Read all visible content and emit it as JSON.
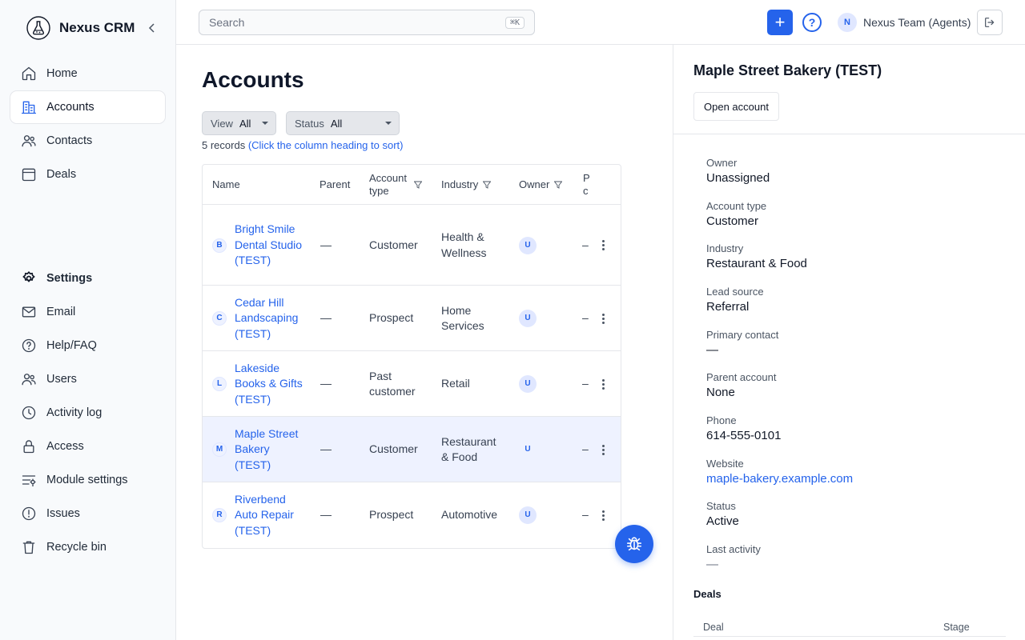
{
  "app": {
    "name": "Nexus CRM"
  },
  "sidebar": {
    "primary": [
      {
        "label": "Home",
        "icon": "home-icon"
      },
      {
        "label": "Accounts",
        "icon": "building-icon",
        "active": true
      },
      {
        "label": "Contacts",
        "icon": "contacts-icon"
      },
      {
        "label": "Deals",
        "icon": "deals-icon"
      }
    ],
    "secondary": [
      {
        "label": "Settings",
        "icon": "settings-icon"
      },
      {
        "label": "Email",
        "icon": "email-icon"
      },
      {
        "label": "Help/FAQ",
        "icon": "help-icon"
      },
      {
        "label": "Users",
        "icon": "users-icon"
      },
      {
        "label": "Activity log",
        "icon": "clock-icon"
      },
      {
        "label": "Access",
        "icon": "lock-icon"
      },
      {
        "label": "Module settings",
        "icon": "sliders-icon"
      },
      {
        "label": "Issues",
        "icon": "alert-icon"
      },
      {
        "label": "Recycle bin",
        "icon": "trash-icon"
      }
    ]
  },
  "topbar": {
    "search_placeholder": "Search",
    "search_shortcut": "⌘K",
    "add_label": "+",
    "help_label": "?",
    "user_initial": "N",
    "user_name": "Nexus Team (Agents)"
  },
  "list": {
    "title": "Accounts",
    "filters": [
      {
        "label": "View",
        "value": "All"
      },
      {
        "label": "Status",
        "value": "All"
      }
    ],
    "record_count": "5 records",
    "sort_hint": "(Click the column heading to sort)",
    "columns": {
      "name": "Name",
      "parent": "Parent",
      "account_type": "Account type",
      "industry": "Industry",
      "owner": "Owner",
      "truncated": "P c"
    },
    "rows": [
      {
        "letter": "B",
        "name": "Bright Smile Dental Studio (TEST)",
        "parent": "—",
        "account_type": "Customer",
        "industry": "Health & Wellness",
        "owner": "U",
        "extra": "–"
      },
      {
        "letter": "C",
        "name": "Cedar Hill Landscaping (TEST)",
        "parent": "—",
        "account_type": "Prospect",
        "industry": "Home Services",
        "owner": "U",
        "extra": "–"
      },
      {
        "letter": "L",
        "name": "Lakeside Books & Gifts (TEST)",
        "parent": "—",
        "account_type": "Past customer",
        "industry": "Retail",
        "owner": "U",
        "extra": "–"
      },
      {
        "letter": "M",
        "name": "Maple Street Bakery (TEST)",
        "parent": "—",
        "account_type": "Customer",
        "industry": "Restaurant & Food",
        "owner": "U",
        "extra": "–",
        "selected": true
      },
      {
        "letter": "R",
        "name": "Riverbend Auto Repair (TEST)",
        "parent": "—",
        "account_type": "Prospect",
        "industry": "Automotive",
        "owner": "U",
        "extra": "–"
      }
    ]
  },
  "detail": {
    "title": "Maple Street Bakery (TEST)",
    "open_label": "Open account",
    "fields": [
      {
        "label": "Owner",
        "value": "Unassigned"
      },
      {
        "label": "Account type",
        "value": "Customer"
      },
      {
        "label": "Industry",
        "value": "Restaurant & Food"
      },
      {
        "label": "Lead source",
        "value": "Referral"
      },
      {
        "label": "Primary contact",
        "value": "—"
      },
      {
        "label": "Parent account",
        "value": "None"
      },
      {
        "label": "Phone",
        "value": "614-555-0101"
      },
      {
        "label": "Website",
        "value": "maple-bakery.example.com",
        "link": true
      },
      {
        "label": "Status",
        "value": "Active"
      },
      {
        "label": "Last activity",
        "value": "—",
        "muted": true
      }
    ],
    "deals_title": "Deals",
    "deals_columns": {
      "deal": "Deal",
      "stage": "Stage"
    }
  },
  "colors": {
    "accent": "#2563eb",
    "selected_row": "#eef2ff",
    "sidebar_bg": "#f8fafc"
  }
}
